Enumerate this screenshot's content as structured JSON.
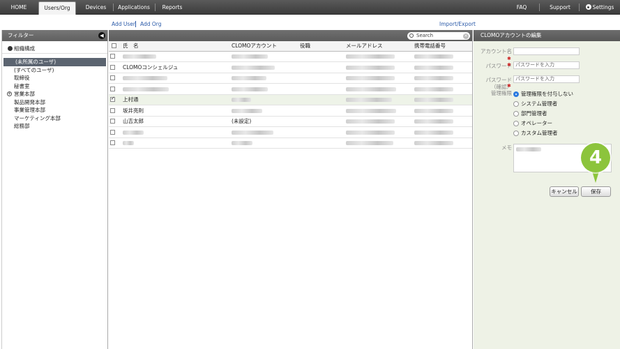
{
  "nav": {
    "tabs": [
      {
        "label": "HOME"
      },
      {
        "label": "Users/Org"
      },
      {
        "label": "Devices"
      },
      {
        "label": "Applications"
      },
      {
        "label": "Reports"
      }
    ],
    "faq": "FAQ",
    "support": "Support",
    "settings": "Settings"
  },
  "actions": {
    "add_user": "Add User",
    "add_org": "Add Org",
    "import_export": "Import/Export"
  },
  "filter": {
    "title": "フィルター",
    "org_root": "組織構成",
    "items": [
      {
        "label": "(未所属のユーザ)"
      },
      {
        "label": "(すべてのユーザ)"
      },
      {
        "label": "取締役"
      },
      {
        "label": "秘書室"
      },
      {
        "label": "営業本部"
      },
      {
        "label": "製品開発本部"
      },
      {
        "label": "事業管理本部"
      },
      {
        "label": "マーケティング本部"
      },
      {
        "label": "総務部"
      }
    ]
  },
  "search": {
    "placeholder": "Search"
  },
  "table": {
    "headers": {
      "name": "氏　名",
      "account": "CLOMOアカウント",
      "title": "役職",
      "email": "メールアドレス",
      "phone": "携帯電話番号"
    },
    "rows": [
      {
        "name": "",
        "account": "",
        "title": "",
        "checked": false
      },
      {
        "name": "CLOMOコンシェルジュ",
        "account": "",
        "title": "",
        "checked": false
      },
      {
        "name": "",
        "account": "",
        "title": "",
        "checked": false
      },
      {
        "name": "",
        "account": "",
        "title": "",
        "checked": false
      },
      {
        "name": "上村通",
        "account": "",
        "title": "",
        "checked": true
      },
      {
        "name": "坂井亮則",
        "account": "",
        "title": "",
        "checked": false
      },
      {
        "name": "山吉太郎",
        "account": "(未設定)",
        "title": "",
        "checked": false
      },
      {
        "name": "",
        "account": "",
        "title": "",
        "checked": false
      },
      {
        "name": "",
        "account": "",
        "title": "",
        "checked": false
      }
    ]
  },
  "edit": {
    "title": "CLOMOアカウントの編集",
    "account_label": "アカウント名",
    "password_label": "パスワード",
    "password_placeholder": "パスワードを入力",
    "confirm_label_1": "パスワード",
    "confirm_label_2": "（確認）",
    "role_label": "管理権限",
    "roles": [
      {
        "label": "管理権限を付与しない",
        "selected": true
      },
      {
        "label": "システム管理者",
        "selected": false
      },
      {
        "label": "部門管理者",
        "selected": false
      },
      {
        "label": "オペレーター",
        "selected": false
      },
      {
        "label": "カスタム管理者",
        "selected": false
      }
    ],
    "memo_label": "メモ",
    "cancel": "キャンセル",
    "save": "保存"
  },
  "step_badge": "4",
  "colors": {
    "accent": "#8cc43c",
    "radio_selected": "#2d7be0",
    "panel_bg": "#eef2e6"
  }
}
